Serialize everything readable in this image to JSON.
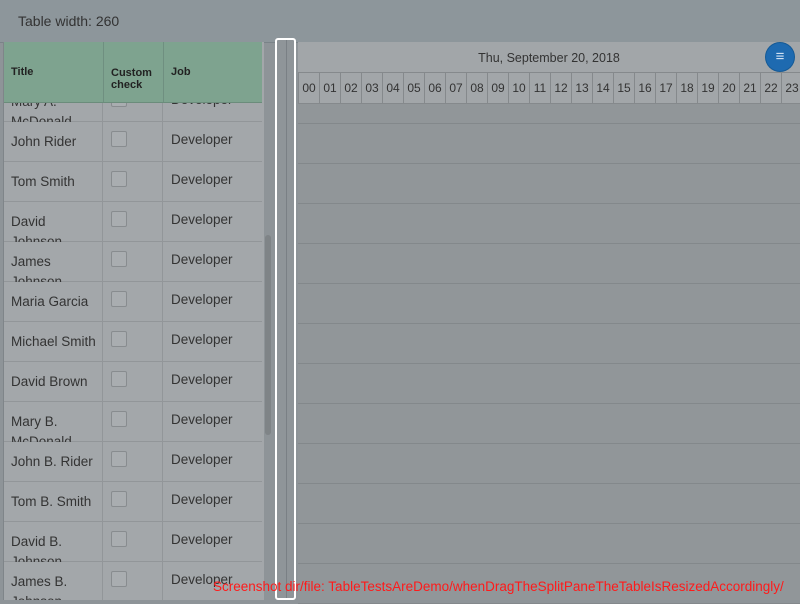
{
  "header": {
    "label": "Table width: 260"
  },
  "table": {
    "columns": {
      "title": "Title",
      "check": "Custom check",
      "job": "Job"
    },
    "rows": [
      {
        "name": "Mary A. McDonald",
        "job": "Developer"
      },
      {
        "name": "John Rider",
        "job": "Developer"
      },
      {
        "name": "Tom Smith",
        "job": "Developer"
      },
      {
        "name": "David Johnson",
        "job": "Developer"
      },
      {
        "name": "James Johnson",
        "job": "Developer"
      },
      {
        "name": "Maria Garcia",
        "job": "Developer"
      },
      {
        "name": "Michael Smith",
        "job": "Developer"
      },
      {
        "name": "David Brown",
        "job": "Developer"
      },
      {
        "name": "Mary B. McDonald",
        "job": "Developer"
      },
      {
        "name": "John B. Rider",
        "job": "Developer"
      },
      {
        "name": "Tom B. Smith",
        "job": "Developer"
      },
      {
        "name": "David B. Johnson",
        "job": "Developer"
      },
      {
        "name": "James B. Johnson",
        "job": "Developer"
      }
    ]
  },
  "timeline": {
    "date": "Thu, September 20, 2018",
    "hours": [
      "00",
      "01",
      "02",
      "03",
      "04",
      "05",
      "06",
      "07",
      "08",
      "09",
      "10",
      "11",
      "12",
      "13",
      "14",
      "15",
      "16",
      "17",
      "18",
      "19",
      "20",
      "21",
      "22",
      "23"
    ]
  },
  "menu_icon": "hamburger-icon",
  "footer_note": "Screenshot dir/file: TableTestsAreDemo/whenDragTheSplitPaneTheTableIsResizedAccordingly/"
}
